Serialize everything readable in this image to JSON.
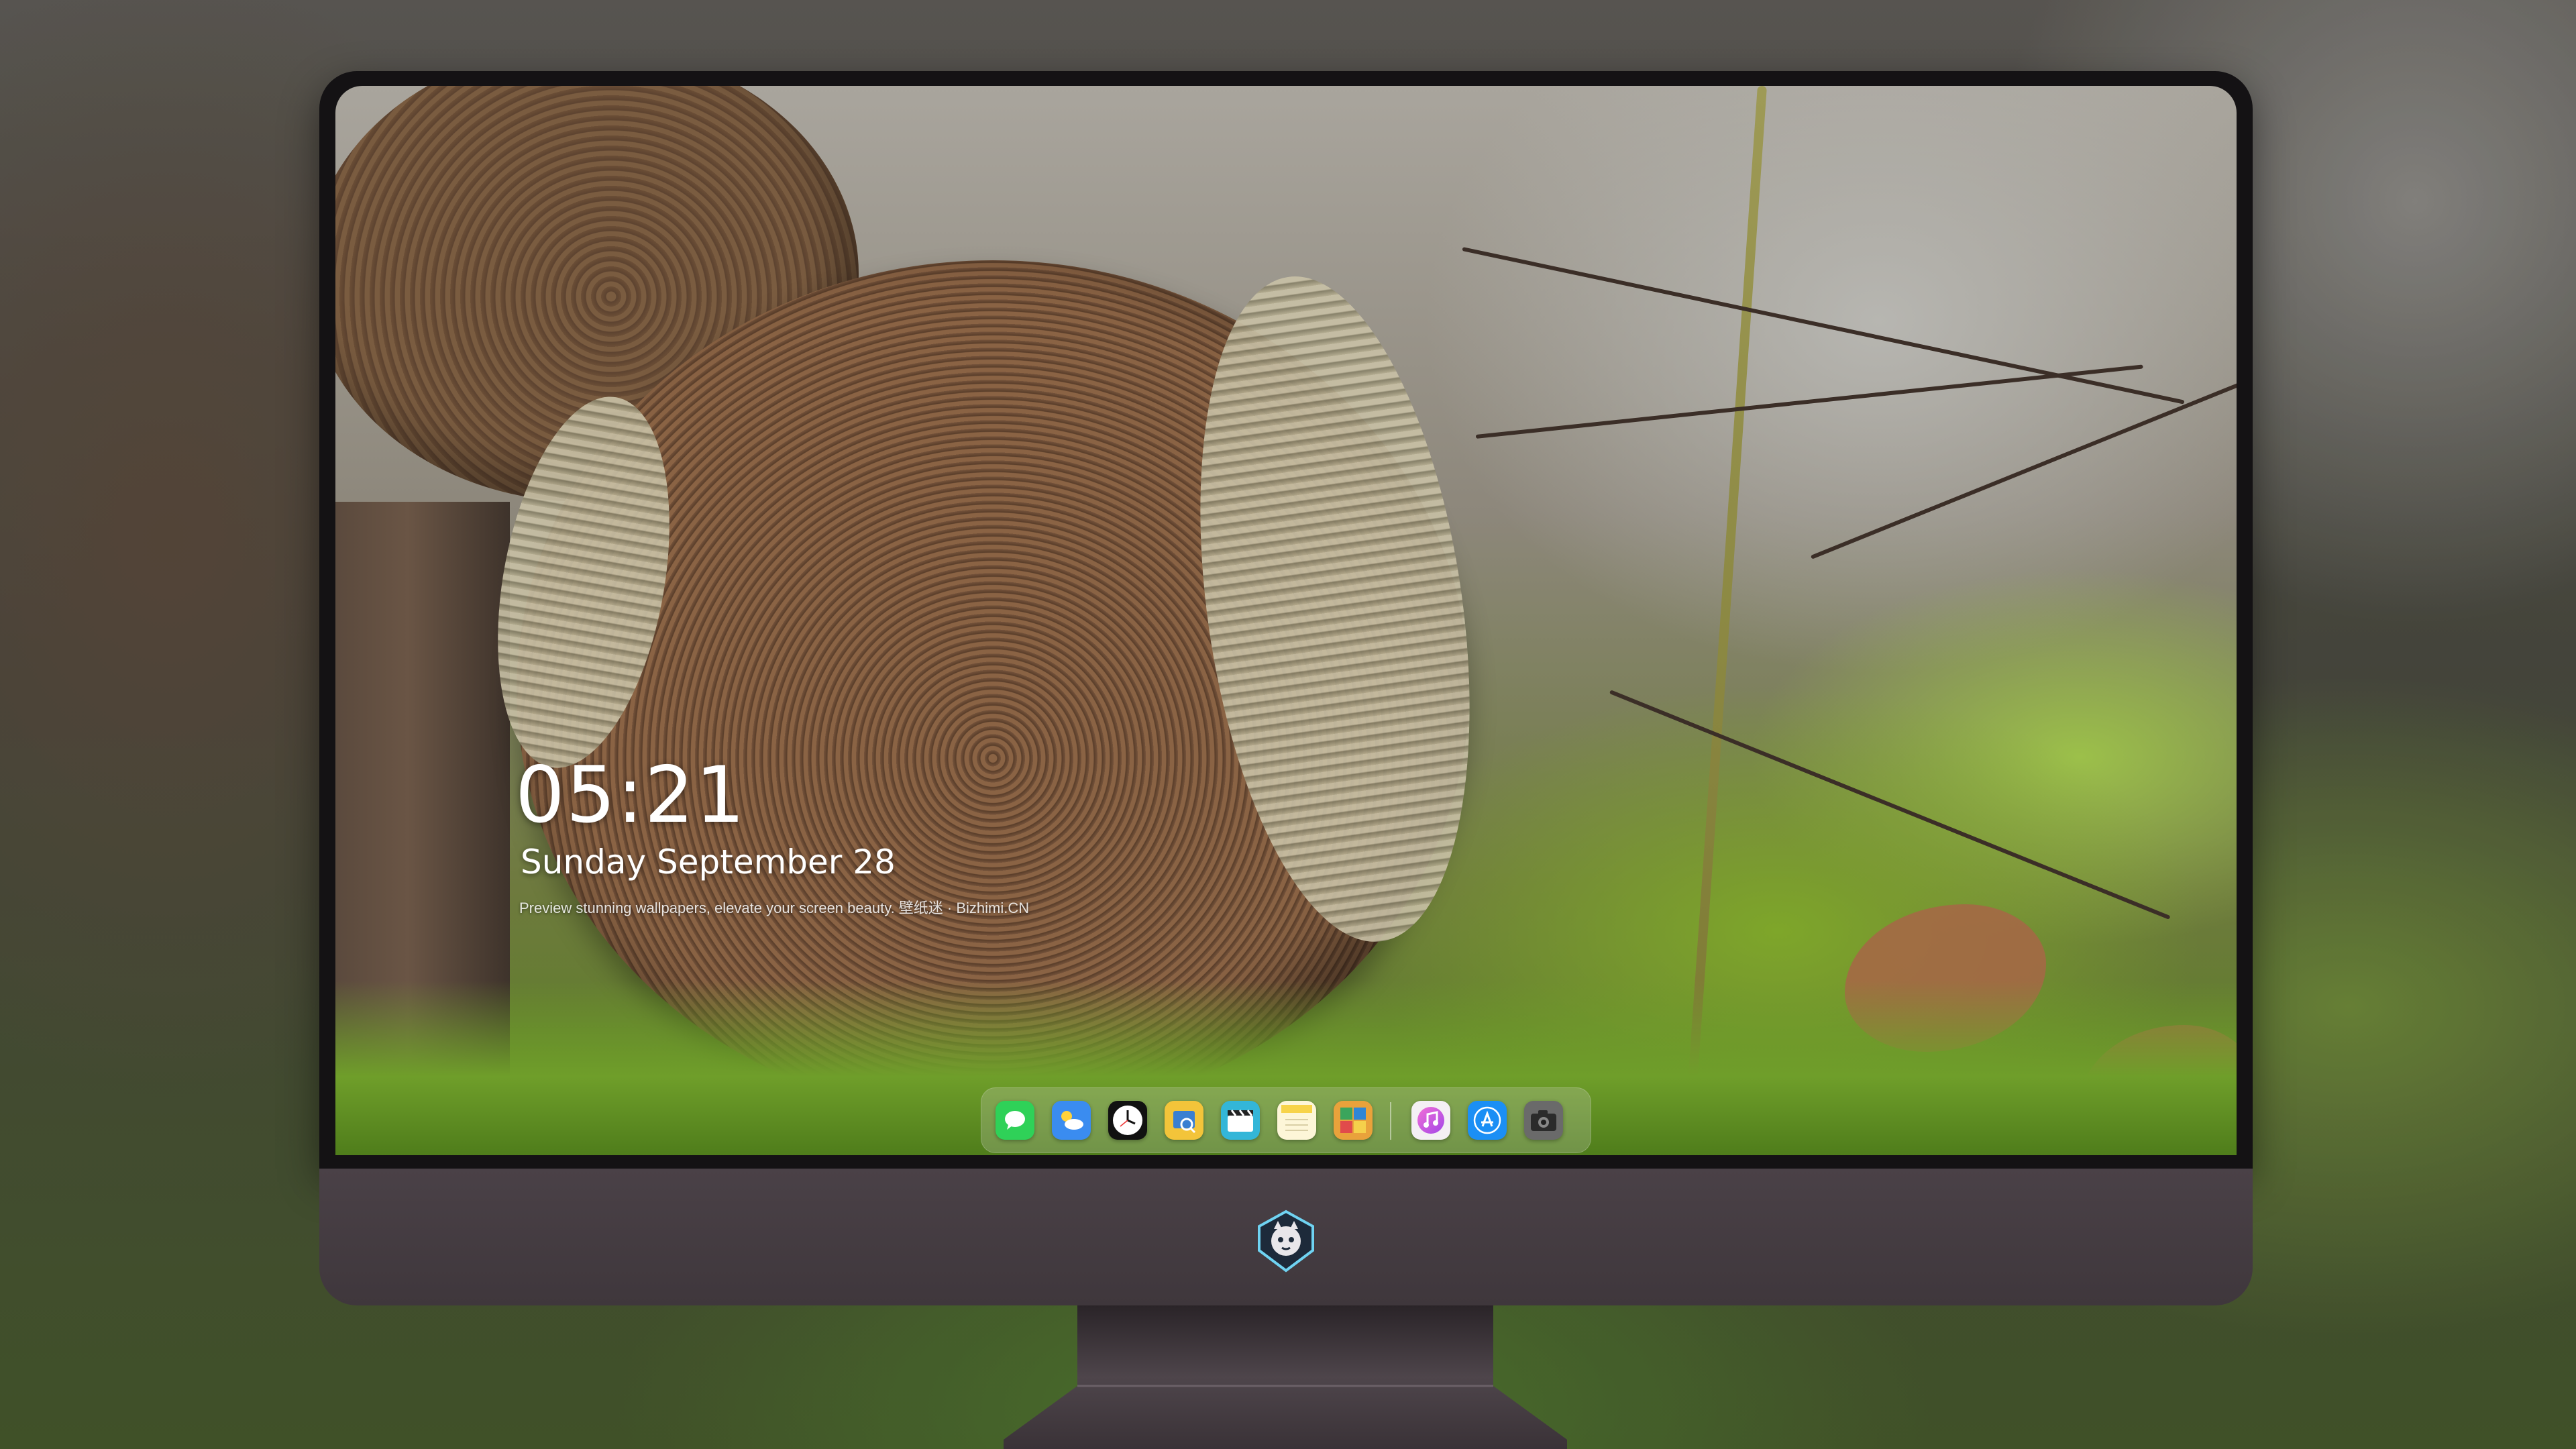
{
  "lockscreen": {
    "time": "05:21",
    "date": "Sunday September  28",
    "caption": "Preview stunning wallpapers, elevate your screen beauty. 壁纸迷 · Bizhimi.CN"
  },
  "dock": {
    "apps": [
      {
        "name": "Messages",
        "icon": "messages-icon",
        "color": "#2fd158"
      },
      {
        "name": "Weather",
        "icon": "weather-icon",
        "color": "#3a8cf0"
      },
      {
        "name": "Clock",
        "icon": "clock-icon",
        "color": "#111111"
      },
      {
        "name": "Preview",
        "icon": "preview-icon",
        "color": "#f3c43a"
      },
      {
        "name": "Clips",
        "icon": "clips-icon",
        "color": "#33b6d8"
      },
      {
        "name": "Notes",
        "icon": "notes-icon",
        "color": "#f7d34a"
      },
      {
        "name": "Photo Booth",
        "icon": "photo-booth-icon",
        "color": "#e9a23b"
      },
      {
        "name": "iTunes",
        "icon": "music-icon",
        "color": "#e05bd3"
      },
      {
        "name": "App Store",
        "icon": "app-store-icon",
        "color": "#1b8ff5"
      },
      {
        "name": "Camera",
        "icon": "camera-icon",
        "color": "#6a6a6a"
      }
    ]
  },
  "chin": {
    "logo": "creature-logo-icon"
  }
}
